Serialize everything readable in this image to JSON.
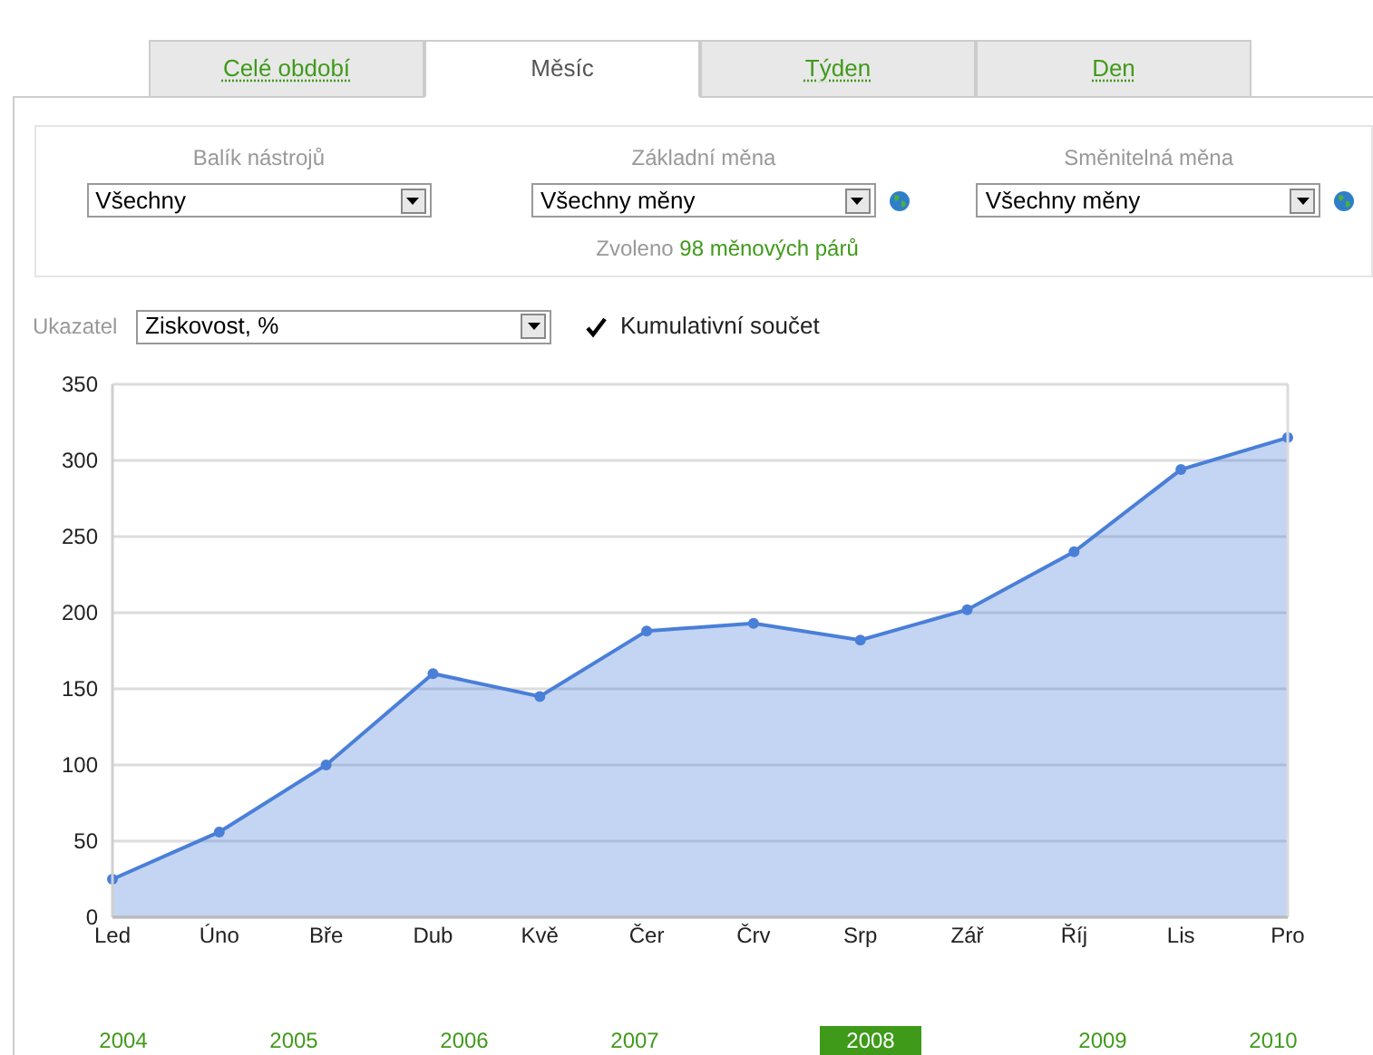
{
  "tabs": [
    {
      "label": "Celé období",
      "selected": false
    },
    {
      "label": "Měsíc",
      "selected": true
    },
    {
      "label": "Týden",
      "selected": false
    },
    {
      "label": "Den",
      "selected": false
    }
  ],
  "filters": [
    {
      "label": "Balík nástrojů",
      "value": "Všechny",
      "globe": false
    },
    {
      "label": "Základní měna",
      "value": "Všechny měny",
      "globe": true
    },
    {
      "label": "Směnitelná měna",
      "value": "Všechny měny",
      "globe": true
    }
  ],
  "selection_note": {
    "prefix": "Zvoleno",
    "link": "98 měnových párů"
  },
  "indicator": {
    "label": "Ukazatel",
    "value": "Ziskovost, %"
  },
  "cumulative": {
    "label": "Kumulativní součet",
    "checked": true
  },
  "chart_data": {
    "type": "area",
    "categories": [
      "Led",
      "Úno",
      "Bře",
      "Dub",
      "Kvě",
      "Čer",
      "Črv",
      "Srp",
      "Zář",
      "Říj",
      "Lis",
      "Pro"
    ],
    "grid": true,
    "series": [
      {
        "color": "#4a7fd8",
        "values": [
          25,
          56,
          100,
          160,
          145,
          188,
          193,
          182,
          202,
          240,
          294,
          315
        ]
      }
    ],
    "ylim": [
      0,
      350
    ],
    "yticks": [
      0,
      50,
      100,
      150,
      200,
      250,
      300,
      350
    ]
  },
  "years": [
    {
      "label": "2004",
      "selected": false
    },
    {
      "label": "2005",
      "selected": false
    },
    {
      "label": "2006",
      "selected": false
    },
    {
      "label": "2007",
      "selected": false
    },
    {
      "label": "2008",
      "selected": true
    },
    {
      "label": "2009",
      "selected": false
    },
    {
      "label": "2010",
      "selected": false
    }
  ]
}
